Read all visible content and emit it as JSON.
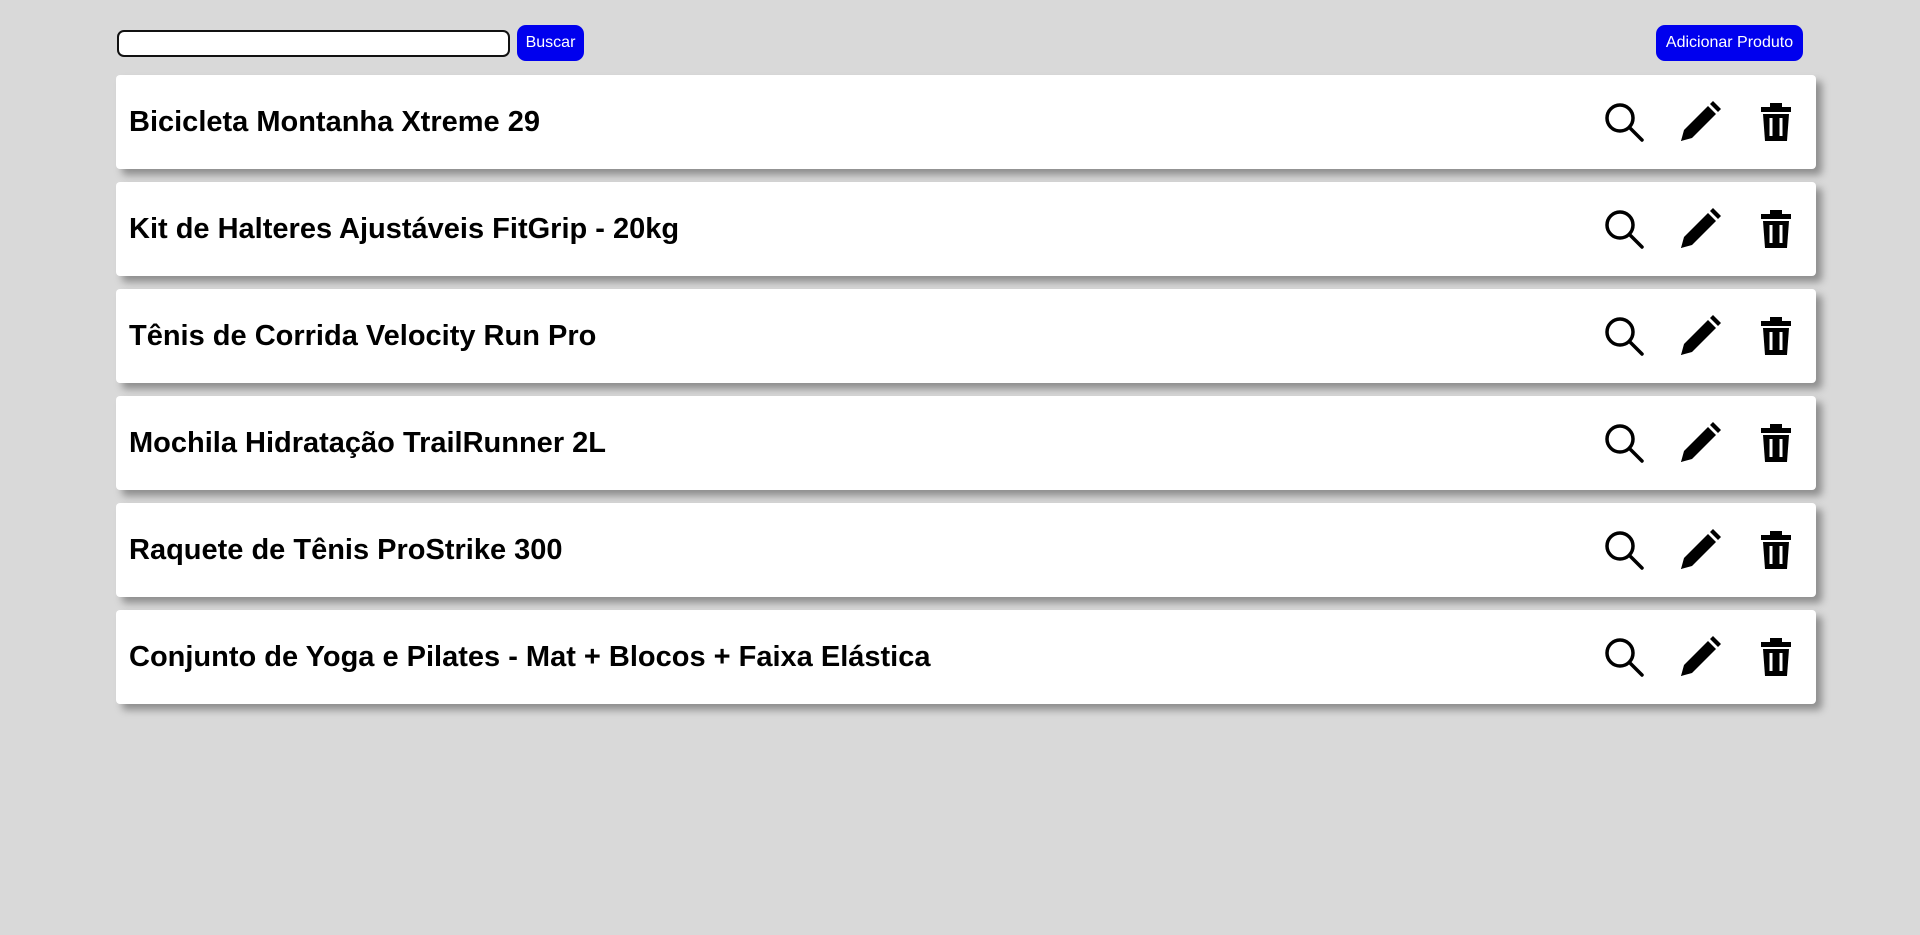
{
  "toolbar": {
    "search_placeholder": "",
    "search_value": "",
    "search_button_label": "Buscar",
    "add_button_label": "Adicionar Produto"
  },
  "colors": {
    "background": "#d9d9d9",
    "accent": "#0000ee",
    "card": "#ffffff"
  },
  "products": [
    {
      "name": "Bicicleta Montanha Xtreme 29"
    },
    {
      "name": "Kit de Halteres Ajustáveis FitGrip - 20kg"
    },
    {
      "name": "Tênis de Corrida Velocity Run Pro"
    },
    {
      "name": "Mochila Hidratação TrailRunner 2L"
    },
    {
      "name": "Raquete de Tênis ProStrike 300"
    },
    {
      "name": "Conjunto de Yoga e Pilates - Mat + Blocos + Faixa Elástica"
    }
  ],
  "row_actions": [
    "search-icon",
    "edit-pencil-icon",
    "trash-icon"
  ]
}
